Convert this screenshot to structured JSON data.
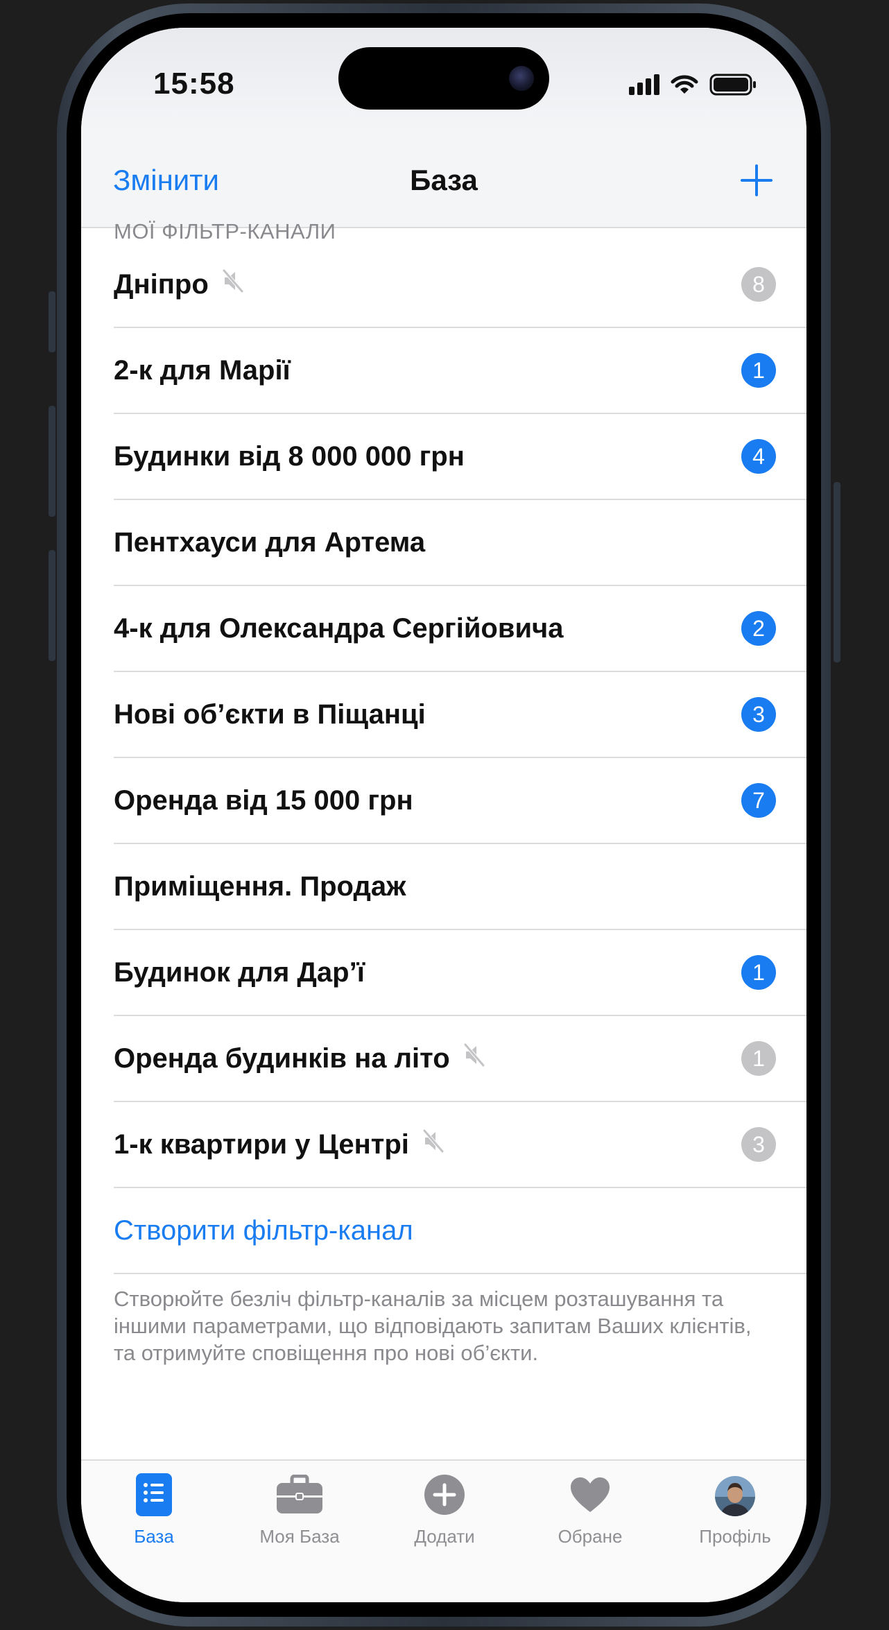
{
  "status_bar": {
    "time": "15:58"
  },
  "nav": {
    "edit_label": "Змінити",
    "title": "База",
    "add_icon": "plus-icon"
  },
  "section_header": "МОЇ ФІЛЬТР-КАНАЛИ",
  "channels": [
    {
      "label": "Дніпро",
      "muted": true,
      "badge": "8",
      "badge_style": "gray"
    },
    {
      "label": "2-к для Марії",
      "muted": false,
      "badge": "1",
      "badge_style": "blue"
    },
    {
      "label": "Будинки від 8 000 000 грн",
      "muted": false,
      "badge": "4",
      "badge_style": "blue"
    },
    {
      "label": "Пентхауси для Артема",
      "muted": false,
      "badge": null,
      "badge_style": null
    },
    {
      "label": "4-к для Олександра Сергійовича",
      "muted": false,
      "badge": "2",
      "badge_style": "blue"
    },
    {
      "label": "Нові об’єкти в Піщанці",
      "muted": false,
      "badge": "3",
      "badge_style": "blue"
    },
    {
      "label": "Оренда від 15 000 грн",
      "muted": false,
      "badge": "7",
      "badge_style": "blue"
    },
    {
      "label": "Приміщення. Продаж",
      "muted": false,
      "badge": null,
      "badge_style": null
    },
    {
      "label": "Будинок для Дар’ї",
      "muted": false,
      "badge": "1",
      "badge_style": "blue"
    },
    {
      "label": "Оренда будинків на літо",
      "muted": true,
      "badge": "1",
      "badge_style": "gray"
    },
    {
      "label": "1-к квартири у Центрі",
      "muted": true,
      "badge": "3",
      "badge_style": "gray"
    }
  ],
  "create_label": "Створити фільтр-канал",
  "footer_text": "Створюйте безліч фільтр-каналів за місцем розташування та іншими параметрами, що відповідають запитам Ваших клієнтів, та отримуйте сповіщення про нові об’єкти.",
  "tabs": [
    {
      "label": "База",
      "icon": "list-icon",
      "active": true
    },
    {
      "label": "Моя База",
      "icon": "briefcase-icon",
      "active": false
    },
    {
      "label": "Додати",
      "icon": "plus-circle-icon",
      "active": false
    },
    {
      "label": "Обране",
      "icon": "heart-icon",
      "active": false
    },
    {
      "label": "Профіль",
      "icon": "avatar",
      "active": false
    }
  ],
  "colors": {
    "accent": "#1a7cf1",
    "badge_gray": "#c4c4c7",
    "secondary_text": "#8a8a8e"
  }
}
